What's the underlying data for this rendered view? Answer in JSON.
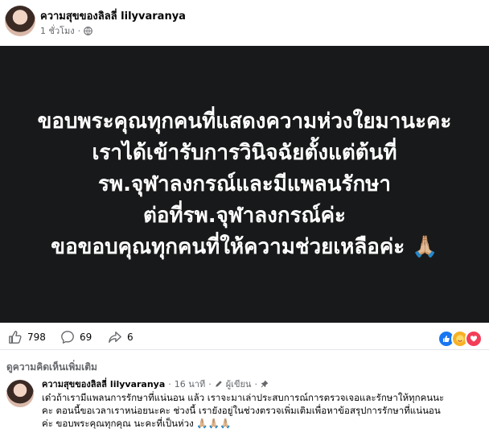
{
  "post": {
    "author": "ความสุขของลิลลี่",
    "handle": "lilyvaranya",
    "time": "1 ชั่วโมง",
    "separator": "·",
    "banner_lines": [
      "ขอบพระคุณทุกคนที่แสดงความห่วงใยมานะคะ",
      "เราได้เข้ารับการวินิจฉัยตั้งแต่ต้นที่",
      "รพ.จุฬาลงกรณ์และมีแพลนรักษา",
      "ต่อที่รพ.จุฬาลงกรณ์ค่ะ",
      "ขอขอบคุณทุกคนที่ให้ความช่วยเหลือค่ะ 🙏🏼"
    ]
  },
  "reactions": {
    "likes": "798",
    "comments": "69",
    "shares": "6",
    "emoji_colors": {
      "like": "#1877f2",
      "care": "#f7b125",
      "love": "#f33e58"
    }
  },
  "comments_section": {
    "view_more": "ดูความคิดเห็นเพิ่มเติม",
    "comment": {
      "author": "ความสุขของลิลลี่",
      "handle": "lilyvaranya",
      "time": "16 นาที",
      "badge": "ผู้เขียน",
      "separator": "·",
      "lines": [
        "เด๋วถ้าเรามีแพลนการรักษาที่แน่นอน แล้ว เราจะมาเล่าประสบการณ์การตรวจเจอและรักษาให้ทุกคนนะ",
        "คะ ตอนนี้ขอเวลาเราหน่อยนะคะ ช่วงนี้ เรายังอยู่ในช่วงตรวจเพิ่มเติมเพื่อหาข้อสรุปการรักษาที่แน่นอน",
        "ค่ะ ขอบพระคุณทุกคุณ นะคะที่เป็นห่วง 🙏🏼🙏🏼🙏🏼"
      ]
    }
  }
}
